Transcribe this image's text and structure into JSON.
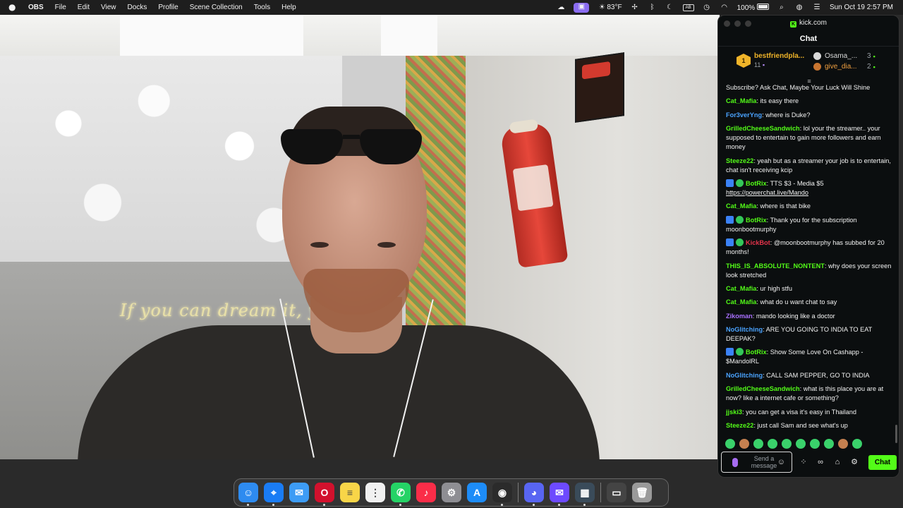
{
  "menubar": {
    "app_name": "OBS",
    "menus": [
      "File",
      "Edit",
      "View",
      "Docks",
      "Profile",
      "Scene Collection",
      "Tools",
      "Help"
    ],
    "weather": "83°F",
    "battery": "100%",
    "datetime": "Sun Oct 19  2:57 PM"
  },
  "scene": {
    "neon_sign": "If you can dream it, you can d"
  },
  "browser": {
    "url": "kick.com",
    "chat_title": "Chat"
  },
  "leaderboard": {
    "top": {
      "rank": "1",
      "name": "bestfriendpla...",
      "count": "11"
    },
    "others": [
      {
        "name": "Osama_...",
        "count": "3",
        "color": "#d9d9d9"
      },
      {
        "name": "give_dia...",
        "count": "2",
        "color": "#f0a040"
      }
    ]
  },
  "messages": [
    {
      "user": "",
      "text": "Subscribe? Ask Chat, Maybe Your Luck Will Shine",
      "color": "#f2f2f2",
      "bot": false
    },
    {
      "user": "Cat_Mafia",
      "text": "its easy there",
      "color": "#53fc18",
      "bot": false
    },
    {
      "user": "For3verYng",
      "text": "where is Duke?",
      "color": "#4aa3ff",
      "bot": false
    },
    {
      "user": "GrilledCheeseSandwich",
      "text": "lol your the streamer.. your supposed to entertain to gain more followers and earn money",
      "color": "#53fc18",
      "bot": false
    },
    {
      "user": "Steeze22",
      "text": "yeah but as a streamer your job is to entertain, chat isn't receiving kcip",
      "color": "#53fc18",
      "bot": false
    },
    {
      "user": "BotRix",
      "text": "TTS $3 - Media $5 ",
      "link": "https://powerchat.live/Mando",
      "color": "#53fc18",
      "bot": true
    },
    {
      "user": "Cat_Mafia",
      "text": "where is that bike",
      "color": "#53fc18",
      "bot": false
    },
    {
      "user": "BotRix",
      "text": "Thank you for the subscription moonbootmurphy",
      "color": "#53fc18",
      "bot": true
    },
    {
      "user": "KickBot",
      "text": "@moonbootmurphy has subbed for 20 months!",
      "color": "#e5334b",
      "bot": true
    },
    {
      "user": "THIS_IS_ABSOLUTE_NONTENT",
      "text": "why does your screen look stretched",
      "color": "#53fc18",
      "bot": false
    },
    {
      "user": "Cat_Mafia",
      "text": "ur high stfu",
      "color": "#53fc18",
      "bot": false
    },
    {
      "user": "Cat_Mafia",
      "text": "what do u want chat to say",
      "color": "#53fc18",
      "bot": false
    },
    {
      "user": "Zikoman",
      "text": "mando looking like a doctor",
      "color": "#a970ff",
      "bot": false
    },
    {
      "user": "NoGlitching",
      "text": "ARE YOU GOING TO INDIA TO EAT DEEPAK?",
      "color": "#4aa3ff",
      "bot": false
    },
    {
      "user": "BotRix",
      "text": "Show Some Love On Cashapp - $MandolRL",
      "color": "#53fc18",
      "bot": true
    },
    {
      "user": "NoGlitching",
      "text": "CALL SAM PEPPER, GO TO INDIA",
      "color": "#4aa3ff",
      "bot": false
    },
    {
      "user": "GrilledCheeseSandwich",
      "text": "what is this place you are at now? like a internet cafe or something?",
      "color": "#53fc18",
      "bot": false
    },
    {
      "user": "jjski3",
      "text": "you can get a visa it's easy in Thailand",
      "color": "#53fc18",
      "bot": false
    },
    {
      "user": "Steeze22",
      "text": "just call Sam and see what's up",
      "color": "#53fc18",
      "bot": false
    }
  ],
  "composer": {
    "placeholder": "Send a message",
    "chat_button": "Chat"
  },
  "dock": {
    "apps": [
      {
        "name": "finder",
        "color": "#2e8bf0",
        "glyph": "☺"
      },
      {
        "name": "safari",
        "color": "#1a7cf5",
        "glyph": "⌖"
      },
      {
        "name": "mail",
        "color": "#3d9cf5",
        "glyph": "✉"
      },
      {
        "name": "opera",
        "color": "#d2112d",
        "glyph": "O"
      },
      {
        "name": "notes",
        "color": "#f8d548",
        "glyph": "≡"
      },
      {
        "name": "reminders",
        "color": "#f1f1f1",
        "glyph": "⋮"
      },
      {
        "name": "whatsapp",
        "color": "#25d366",
        "glyph": "✆"
      },
      {
        "name": "music",
        "color": "#fa2d48",
        "glyph": "♪"
      },
      {
        "name": "system-settings",
        "color": "#8e8e93",
        "glyph": "⚙"
      },
      {
        "name": "app-store",
        "color": "#1d8cf8",
        "glyph": "A"
      },
      {
        "name": "obs",
        "color": "#2b2b2b",
        "glyph": "◉"
      },
      {
        "name": "discord",
        "color": "#5865f2",
        "glyph": "◕"
      },
      {
        "name": "proton-mail",
        "color": "#6d4aff",
        "glyph": "✉"
      },
      {
        "name": "photos-grid",
        "color": "#3a4b5a",
        "glyph": "▦"
      },
      {
        "name": "screenshot-thumb",
        "color": "#444444",
        "glyph": "▭"
      },
      {
        "name": "trash",
        "color": "#9a9a9a",
        "glyph": "🗑"
      }
    ]
  }
}
